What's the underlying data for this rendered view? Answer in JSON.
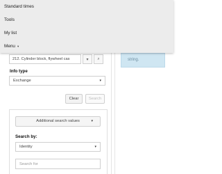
{
  "menu": {
    "items": [
      {
        "label": "Standard times"
      },
      {
        "label": "Tools"
      },
      {
        "label": "My list"
      },
      {
        "label": "Menu"
      }
    ],
    "menu_caret": "▾"
  },
  "part": {
    "selected": "212. Cylinder block, flywheel cas"
  },
  "info_type": {
    "label": "Info type",
    "selected": "Exchange"
  },
  "buttons": {
    "clear": "Clear",
    "search": "Search"
  },
  "search_panel": {
    "additional_values": "Additional search values",
    "search_by_label": "Search by:",
    "search_by_selected": "Identity",
    "search_for_placeholder": "Search for"
  },
  "info_box": {
    "text": "string."
  },
  "icons": {
    "dropdown_caret": "▾",
    "search_button_icon": "⌕"
  }
}
